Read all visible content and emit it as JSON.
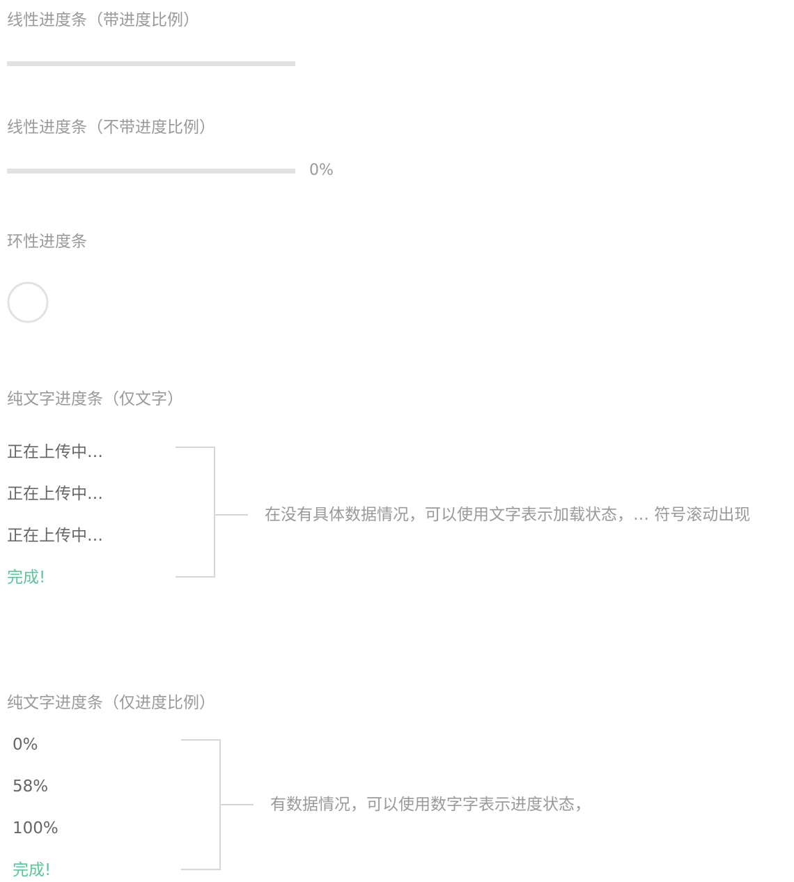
{
  "sections": {
    "linear_with_ratio": {
      "title": "线性进度条（带进度比例）",
      "progress": 0
    },
    "linear_no_ratio": {
      "title": "线性进度条（不带进度比例）",
      "progress": 0,
      "percent_label": "0%"
    },
    "circular": {
      "title": "环性进度条",
      "progress": 0
    },
    "text_only": {
      "title": "纯文字进度条（仅文字）",
      "items": [
        "正在上传中…",
        "正在上传中…",
        "正在上传中…"
      ],
      "done": "完成!",
      "note": "在没有具体数据情况，可以使用文字表示加载状态，… 符号滚动出现"
    },
    "ratio_only": {
      "title": "纯文字进度条（仅进度比例）",
      "items": [
        "0%",
        "58%",
        "100%"
      ],
      "done": "完成!",
      "note": "有数据情况，可以使用数字字表示进度状态，"
    }
  },
  "colors": {
    "track": "#e2e2e2",
    "fill": "#19be6b",
    "done": "#5cc59a",
    "muted_text": "#9a9a9a",
    "body_text": "#666666"
  }
}
